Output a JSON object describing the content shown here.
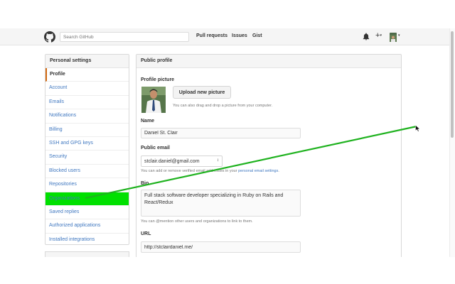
{
  "header": {
    "search_placeholder": "Search GitHub",
    "nav": [
      "Pull requests",
      "Issues",
      "Gist"
    ],
    "plus_label": "+",
    "caret": "▾"
  },
  "sidebar": {
    "title": "Personal settings",
    "items": [
      {
        "label": "Profile",
        "state": "selected"
      },
      {
        "label": "Account"
      },
      {
        "label": "Emails"
      },
      {
        "label": "Notifications"
      },
      {
        "label": "Billing"
      },
      {
        "label": "SSH and GPG keys"
      },
      {
        "label": "Security"
      },
      {
        "label": "Blocked users"
      },
      {
        "label": "Repositories"
      },
      {
        "label": "Organizations",
        "state": "highlighted"
      },
      {
        "label": "Saved replies"
      },
      {
        "label": "Authorized applications"
      },
      {
        "label": "Installed integrations"
      }
    ]
  },
  "main": {
    "title": "Public profile",
    "picture_label": "Profile picture",
    "upload_button": "Upload new picture",
    "upload_note": "You can also drag and drop a picture from your computer.",
    "name_label": "Name",
    "name_value": "Daniel St. Clair",
    "email_label": "Public email",
    "email_value": "stclair.daniel@gmail.com",
    "email_note_prefix": "You can add or remove verified email addresses in your",
    "email_note_link": "personal email settings",
    "email_note_suffix": ".",
    "bio_label": "Bio",
    "bio_value": "Full stack software developer specializing in Ruby on Rails and React/Redux",
    "bio_note": "You can @mention other users and organizations to link to them.",
    "url_label": "URL",
    "url_value": "http://stclairdaniel.me/"
  },
  "colors": {
    "annotation_line": "#1fb21f",
    "highlight": "#00e000",
    "link": "#4078c0",
    "selected_border": "#d26911"
  }
}
